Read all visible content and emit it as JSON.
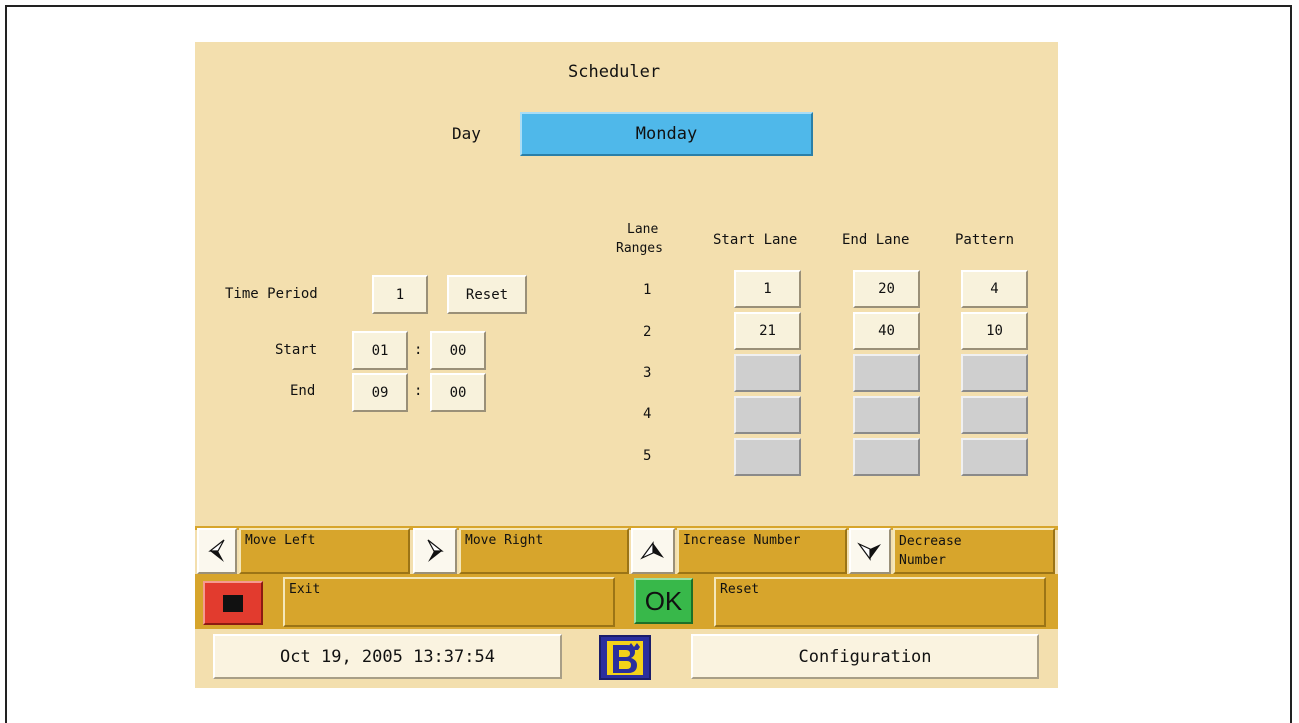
{
  "title": "Scheduler",
  "day": {
    "label": "Day",
    "value": "Monday"
  },
  "time_period": {
    "label": "Time Period",
    "value": "1",
    "reset_label": "Reset"
  },
  "start": {
    "label": "Start",
    "hour": "01",
    "sep": ":",
    "minute": "00"
  },
  "end": {
    "label": "End",
    "hour": "09",
    "sep": ":",
    "minute": "00"
  },
  "lanes": {
    "header_ranges_line1": "Lane",
    "header_ranges_line2": "Ranges",
    "header_start": "Start Lane",
    "header_end": "End Lane",
    "header_pattern": "Pattern",
    "rows": [
      {
        "num": "1",
        "start": "1",
        "end": "20",
        "pattern": "4"
      },
      {
        "num": "2",
        "start": "21",
        "end": "40",
        "pattern": "10"
      },
      {
        "num": "3",
        "start": "",
        "end": "",
        "pattern": ""
      },
      {
        "num": "4",
        "start": "",
        "end": "",
        "pattern": ""
      },
      {
        "num": "5",
        "start": "",
        "end": "",
        "pattern": ""
      }
    ]
  },
  "controls": {
    "move_left": "Move Left",
    "move_right": "Move Right",
    "increase": "Increase Number",
    "decrease_line1": "Decrease",
    "decrease_line2": "Number",
    "exit": "Exit",
    "ok": "OK",
    "reset": "Reset"
  },
  "footer": {
    "datetime": "Oct 19, 2005 13:37:54",
    "configuration": "Configuration"
  },
  "icons": {
    "left": "left-arrow-icon",
    "right": "right-arrow-icon",
    "up": "up-arrow-icon",
    "down": "down-arrow-icon",
    "stop": "stop-icon",
    "logo": "logo-icon"
  },
  "colors": {
    "panel": "#f3dfae",
    "bar": "#d7a52c",
    "day": "#4fb8ea",
    "exit": "#e23b2e",
    "ok": "#38b84a"
  }
}
